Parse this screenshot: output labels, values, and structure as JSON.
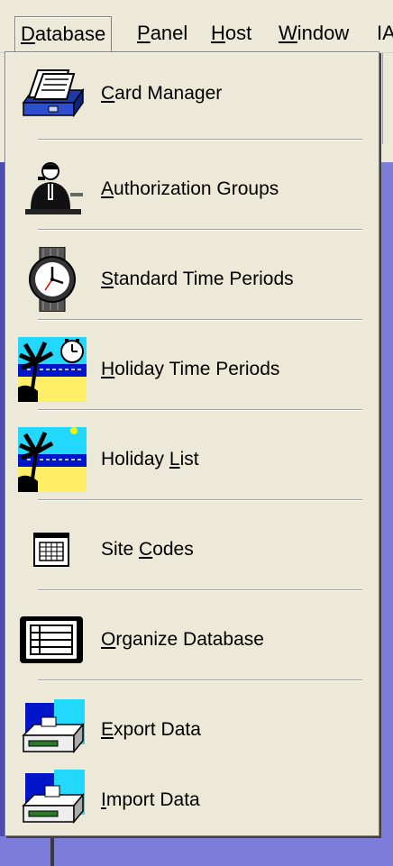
{
  "menubar": {
    "items": [
      {
        "label": "Database",
        "mnemonic": "D"
      },
      {
        "label": "Panel",
        "mnemonic": "P"
      },
      {
        "label": "Host",
        "mnemonic": "H"
      },
      {
        "label": "Window",
        "mnemonic": "W"
      },
      {
        "label": "IA"
      }
    ]
  },
  "menu": {
    "items": [
      {
        "label": "Card Manager",
        "icon": "card-file-icon"
      },
      {
        "label": "Authorization Groups",
        "icon": "security-guard-icon"
      },
      {
        "label": "Standard Time Periods",
        "icon": "wristwatch-icon"
      },
      {
        "label": "Holiday Time Periods",
        "icon": "beach-clock-icon"
      },
      {
        "label": "Holiday List",
        "icon": "beach-icon"
      },
      {
        "label": "Site Codes",
        "icon": "grid-document-icon"
      },
      {
        "label": "Organize Database",
        "icon": "list-document-icon"
      },
      {
        "label": "Export Data",
        "icon": "export-drive-icon"
      },
      {
        "label": "Import Data",
        "icon": "import-drive-icon"
      }
    ]
  }
}
